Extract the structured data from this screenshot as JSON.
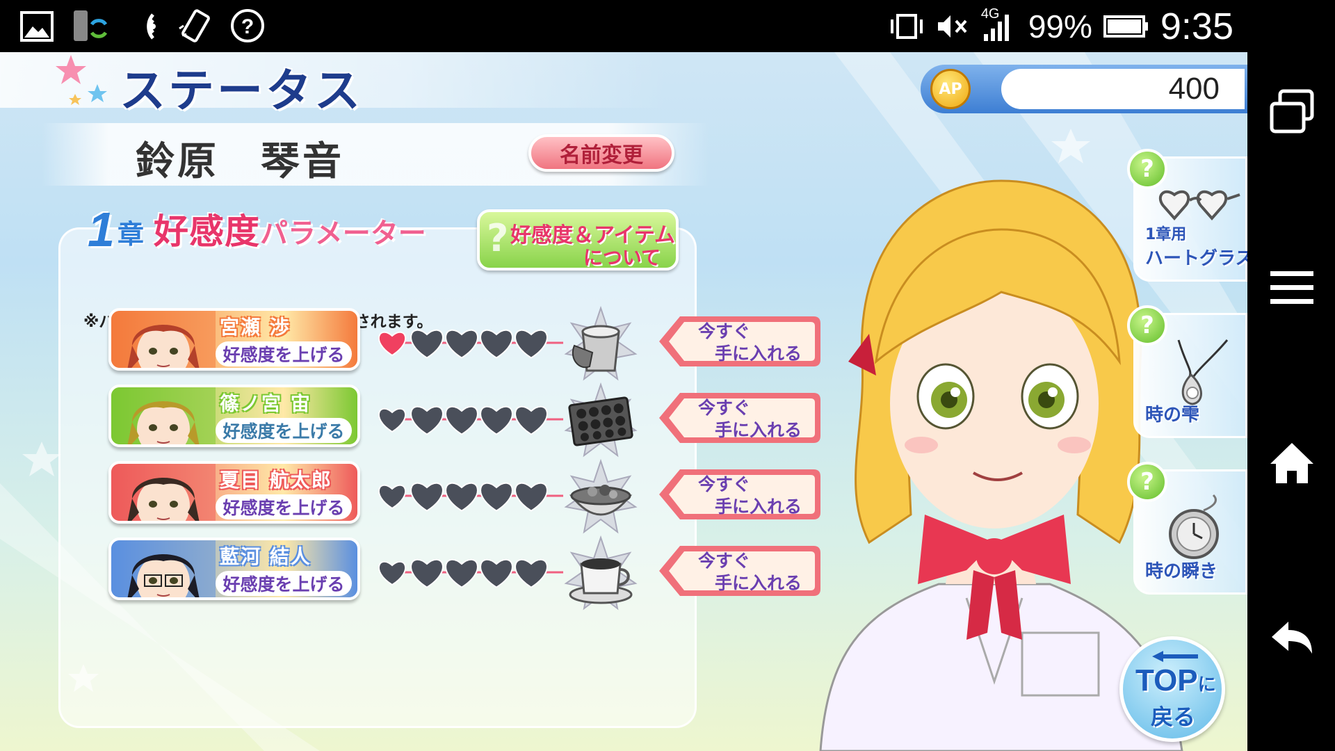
{
  "status_bar": {
    "battery": "99%",
    "time": "9:35",
    "network": "4G"
  },
  "header": {
    "title": "ステータス",
    "ap_label": "AP",
    "ap_value": "400"
  },
  "player": {
    "name": "鈴原　琴音",
    "rename_label": "名前変更"
  },
  "chapter": {
    "number": "1",
    "unit": "章",
    "title_main": "好感度",
    "title_sub": "パラメーター",
    "about_line1": "好感度＆アイテム",
    "about_line2": "について",
    "note": "※パラメーターは各章ごとにリセットされます。"
  },
  "characters": [
    {
      "name": "宮瀬 渉",
      "raise_label": "好感度を上げる",
      "hearts_filled": 1,
      "hearts_total": 5,
      "item_icon": "drink-cup-icon",
      "get_line1": "今すぐ",
      "get_line2": "手に入れる",
      "theme": "#f47a3c"
    },
    {
      "name": "篠ノ宮 宙",
      "raise_label": "好感度を上げる",
      "hearts_filled": 0,
      "hearts_total": 5,
      "item_icon": "chocolate-box-icon",
      "get_line1": "今すぐ",
      "get_line2": "手に入れる",
      "theme": "#7cc832"
    },
    {
      "name": "夏目 航太郎",
      "raise_label": "好感度を上げる",
      "hearts_filled": 0,
      "hearts_total": 5,
      "item_icon": "food-bowl-icon",
      "get_line1": "今すぐ",
      "get_line2": "手に入れる",
      "theme": "#ee5a5a"
    },
    {
      "name": "藍河 結人",
      "raise_label": "好感度を上げる",
      "hearts_filled": 0,
      "hearts_total": 5,
      "item_icon": "coffee-cup-icon",
      "get_line1": "今すぐ",
      "get_line2": "手に入れる",
      "theme": "#5a8fe0"
    }
  ],
  "side_items": [
    {
      "label_prefix": "1章用",
      "label": "ハートグラス",
      "icon": "heart-glasses-icon"
    },
    {
      "label_prefix": "",
      "label": "時の雫",
      "icon": "pendant-icon"
    },
    {
      "label_prefix": "",
      "label": "時の瞬き",
      "icon": "pocket-watch-icon"
    }
  ],
  "top_button": {
    "line1": "TOP",
    "line1_suffix": "に",
    "line2": "戻る"
  },
  "colors": {
    "heart_filled": "#f04060",
    "heart_empty": "#4a4f5a",
    "title": "#1e3c8c",
    "accent_pink": "#e8356a"
  }
}
